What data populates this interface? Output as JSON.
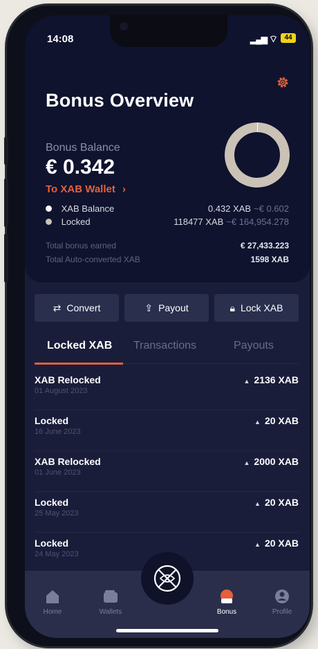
{
  "status": {
    "time": "14:08",
    "battery": "44",
    "signal_icon": "signal-icon",
    "wifi_icon": "wifi-icon"
  },
  "header": {
    "title": "Bonus Overview",
    "settings_icon": "gear-icon"
  },
  "balance": {
    "label": "Bonus Balance",
    "value": "€ 0.342"
  },
  "donut": {
    "locked_fraction": 0.999,
    "balance_fraction": 0.001,
    "locked_color": "#cbc2b6",
    "balance_color": "#ffffff"
  },
  "wallet_link": {
    "label": "To XAB Wallet",
    "chevron": "›"
  },
  "legend": [
    {
      "label": "XAB Balance",
      "xab": "0.432 XAB",
      "eur": "~€ 0.602",
      "color": "#ffffff"
    },
    {
      "label": "Locked",
      "xab": "118477 XAB",
      "eur": "~€ 164,954.278",
      "color": "#cbc2b6"
    }
  ],
  "totals": [
    {
      "label": "Total bonus earned",
      "value": "€ 27,433.223"
    },
    {
      "label": "Total Auto-converted XAB",
      "value": "1598 XAB"
    }
  ],
  "actions": [
    {
      "label": "Convert",
      "icon": "swap-icon"
    },
    {
      "label": "Payout",
      "icon": "upload-icon"
    },
    {
      "label": "Lock XAB",
      "icon": "lock-icon"
    }
  ],
  "tabs": [
    {
      "label": "Locked XAB",
      "active": true
    },
    {
      "label": "Transactions",
      "active": false
    },
    {
      "label": "Payouts",
      "active": false
    }
  ],
  "items": [
    {
      "name": "XAB Relocked",
      "date": "01 August 2023",
      "amount": "2136 XAB"
    },
    {
      "name": "Locked",
      "date": "16 June 2023",
      "amount": "20 XAB"
    },
    {
      "name": "XAB Relocked",
      "date": "01 June 2023",
      "amount": "2000 XAB"
    },
    {
      "name": "Locked",
      "date": "25 May 2023",
      "amount": "20 XAB"
    },
    {
      "name": "Locked",
      "date": "24 May 2023",
      "amount": "20 XAB"
    }
  ],
  "nav": [
    {
      "label": "Home",
      "icon": "home-icon",
      "active": false
    },
    {
      "label": "Wallets",
      "icon": "wallet-icon",
      "active": false
    },
    {
      "label": "",
      "icon": "globe-icon",
      "active": false
    },
    {
      "label": "Bonus",
      "icon": "bonus-icon",
      "active": true
    },
    {
      "label": "Profile",
      "icon": "profile-icon",
      "active": false
    }
  ],
  "colors": {
    "accent": "#e3603b",
    "background": "#1a1d3a",
    "card": "#0f132e",
    "button": "#2a2f4e"
  }
}
